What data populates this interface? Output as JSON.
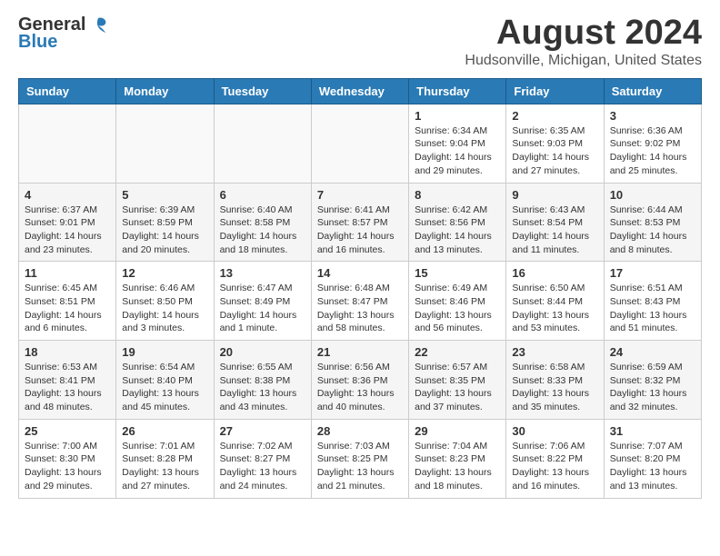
{
  "header": {
    "logo_general": "General",
    "logo_blue": "Blue",
    "month_year": "August 2024",
    "location": "Hudsonville, Michigan, United States"
  },
  "days_of_week": [
    "Sunday",
    "Monday",
    "Tuesday",
    "Wednesday",
    "Thursday",
    "Friday",
    "Saturday"
  ],
  "weeks": [
    [
      {
        "day": "",
        "empty": true
      },
      {
        "day": "",
        "empty": true
      },
      {
        "day": "",
        "empty": true
      },
      {
        "day": "",
        "empty": true
      },
      {
        "day": "1",
        "sunrise": "6:34 AM",
        "sunset": "9:04 PM",
        "daylight": "14 hours and 29 minutes."
      },
      {
        "day": "2",
        "sunrise": "6:35 AM",
        "sunset": "9:03 PM",
        "daylight": "14 hours and 27 minutes."
      },
      {
        "day": "3",
        "sunrise": "6:36 AM",
        "sunset": "9:02 PM",
        "daylight": "14 hours and 25 minutes."
      }
    ],
    [
      {
        "day": "4",
        "sunrise": "6:37 AM",
        "sunset": "9:01 PM",
        "daylight": "14 hours and 23 minutes."
      },
      {
        "day": "5",
        "sunrise": "6:39 AM",
        "sunset": "8:59 PM",
        "daylight": "14 hours and 20 minutes."
      },
      {
        "day": "6",
        "sunrise": "6:40 AM",
        "sunset": "8:58 PM",
        "daylight": "14 hours and 18 minutes."
      },
      {
        "day": "7",
        "sunrise": "6:41 AM",
        "sunset": "8:57 PM",
        "daylight": "14 hours and 16 minutes."
      },
      {
        "day": "8",
        "sunrise": "6:42 AM",
        "sunset": "8:56 PM",
        "daylight": "14 hours and 13 minutes."
      },
      {
        "day": "9",
        "sunrise": "6:43 AM",
        "sunset": "8:54 PM",
        "daylight": "14 hours and 11 minutes."
      },
      {
        "day": "10",
        "sunrise": "6:44 AM",
        "sunset": "8:53 PM",
        "daylight": "14 hours and 8 minutes."
      }
    ],
    [
      {
        "day": "11",
        "sunrise": "6:45 AM",
        "sunset": "8:51 PM",
        "daylight": "14 hours and 6 minutes."
      },
      {
        "day": "12",
        "sunrise": "6:46 AM",
        "sunset": "8:50 PM",
        "daylight": "14 hours and 3 minutes."
      },
      {
        "day": "13",
        "sunrise": "6:47 AM",
        "sunset": "8:49 PM",
        "daylight": "14 hours and 1 minute."
      },
      {
        "day": "14",
        "sunrise": "6:48 AM",
        "sunset": "8:47 PM",
        "daylight": "13 hours and 58 minutes."
      },
      {
        "day": "15",
        "sunrise": "6:49 AM",
        "sunset": "8:46 PM",
        "daylight": "13 hours and 56 minutes."
      },
      {
        "day": "16",
        "sunrise": "6:50 AM",
        "sunset": "8:44 PM",
        "daylight": "13 hours and 53 minutes."
      },
      {
        "day": "17",
        "sunrise": "6:51 AM",
        "sunset": "8:43 PM",
        "daylight": "13 hours and 51 minutes."
      }
    ],
    [
      {
        "day": "18",
        "sunrise": "6:53 AM",
        "sunset": "8:41 PM",
        "daylight": "13 hours and 48 minutes."
      },
      {
        "day": "19",
        "sunrise": "6:54 AM",
        "sunset": "8:40 PM",
        "daylight": "13 hours and 45 minutes."
      },
      {
        "day": "20",
        "sunrise": "6:55 AM",
        "sunset": "8:38 PM",
        "daylight": "13 hours and 43 minutes."
      },
      {
        "day": "21",
        "sunrise": "6:56 AM",
        "sunset": "8:36 PM",
        "daylight": "13 hours and 40 minutes."
      },
      {
        "day": "22",
        "sunrise": "6:57 AM",
        "sunset": "8:35 PM",
        "daylight": "13 hours and 37 minutes."
      },
      {
        "day": "23",
        "sunrise": "6:58 AM",
        "sunset": "8:33 PM",
        "daylight": "13 hours and 35 minutes."
      },
      {
        "day": "24",
        "sunrise": "6:59 AM",
        "sunset": "8:32 PM",
        "daylight": "13 hours and 32 minutes."
      }
    ],
    [
      {
        "day": "25",
        "sunrise": "7:00 AM",
        "sunset": "8:30 PM",
        "daylight": "13 hours and 29 minutes."
      },
      {
        "day": "26",
        "sunrise": "7:01 AM",
        "sunset": "8:28 PM",
        "daylight": "13 hours and 27 minutes."
      },
      {
        "day": "27",
        "sunrise": "7:02 AM",
        "sunset": "8:27 PM",
        "daylight": "13 hours and 24 minutes."
      },
      {
        "day": "28",
        "sunrise": "7:03 AM",
        "sunset": "8:25 PM",
        "daylight": "13 hours and 21 minutes."
      },
      {
        "day": "29",
        "sunrise": "7:04 AM",
        "sunset": "8:23 PM",
        "daylight": "13 hours and 18 minutes."
      },
      {
        "day": "30",
        "sunrise": "7:06 AM",
        "sunset": "8:22 PM",
        "daylight": "13 hours and 16 minutes."
      },
      {
        "day": "31",
        "sunrise": "7:07 AM",
        "sunset": "8:20 PM",
        "daylight": "13 hours and 13 minutes."
      }
    ]
  ]
}
